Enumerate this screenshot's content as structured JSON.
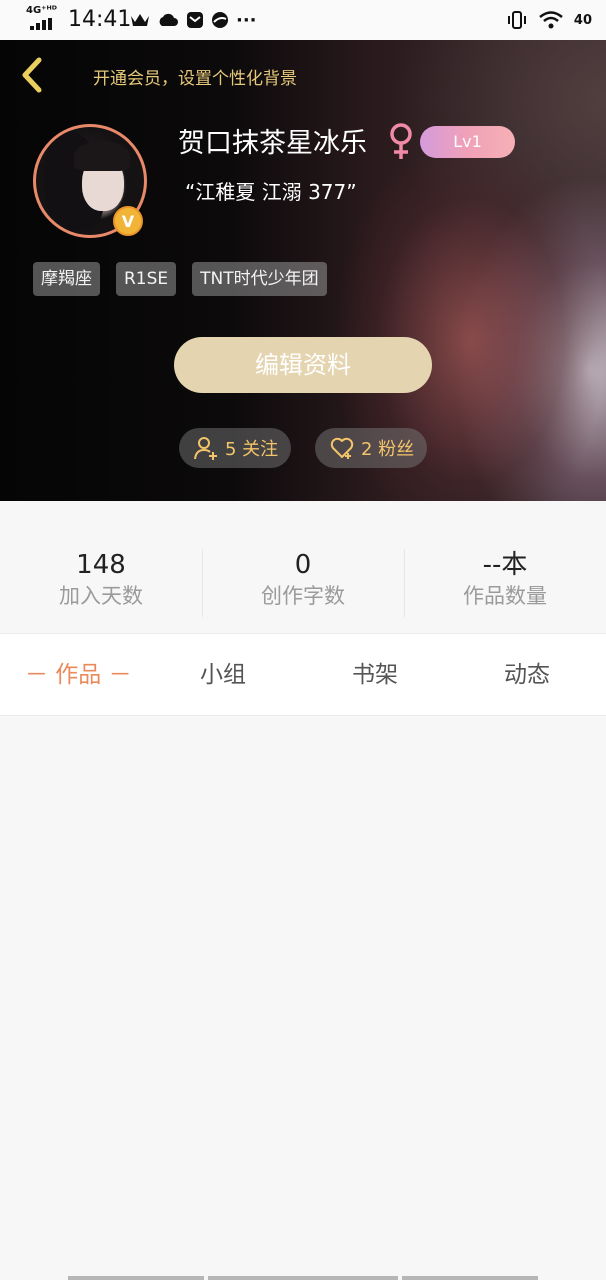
{
  "status_bar": {
    "network": "4G⁺ᴴᴰ",
    "time": "14:41",
    "more": "···",
    "battery": "40"
  },
  "header": {
    "promo_text": "开通会员，设置个性化背景",
    "username": "贺口抹茶星冰乐",
    "gender_symbol": "♀",
    "level": "Lv1",
    "signature": "“江稚夏 江溺 377”",
    "verified_badge": "V",
    "tags": [
      "摩羯座",
      "R1SE",
      "TNT时代少年团"
    ],
    "edit_button": "编辑资料",
    "following": "5 关注",
    "fans": "2 粉丝",
    "colors": {
      "accent_gold": "#e6c97a",
      "gender_pink": "#f08aa6",
      "edit_bg": "#e4d5b0"
    }
  },
  "stats": [
    {
      "value": "148",
      "label": "加入天数"
    },
    {
      "value": "0",
      "label": "创作字数"
    },
    {
      "value": "--本",
      "label": "作品数量"
    }
  ],
  "tabs": [
    {
      "label": "－ 作品 －",
      "active": true
    },
    {
      "label": "小组",
      "active": false
    },
    {
      "label": "书架",
      "active": false
    },
    {
      "label": "动态",
      "active": false
    }
  ],
  "icons": {
    "back": "chevron-left-icon",
    "follow": "add-user-icon",
    "fans": "heart-icon"
  }
}
